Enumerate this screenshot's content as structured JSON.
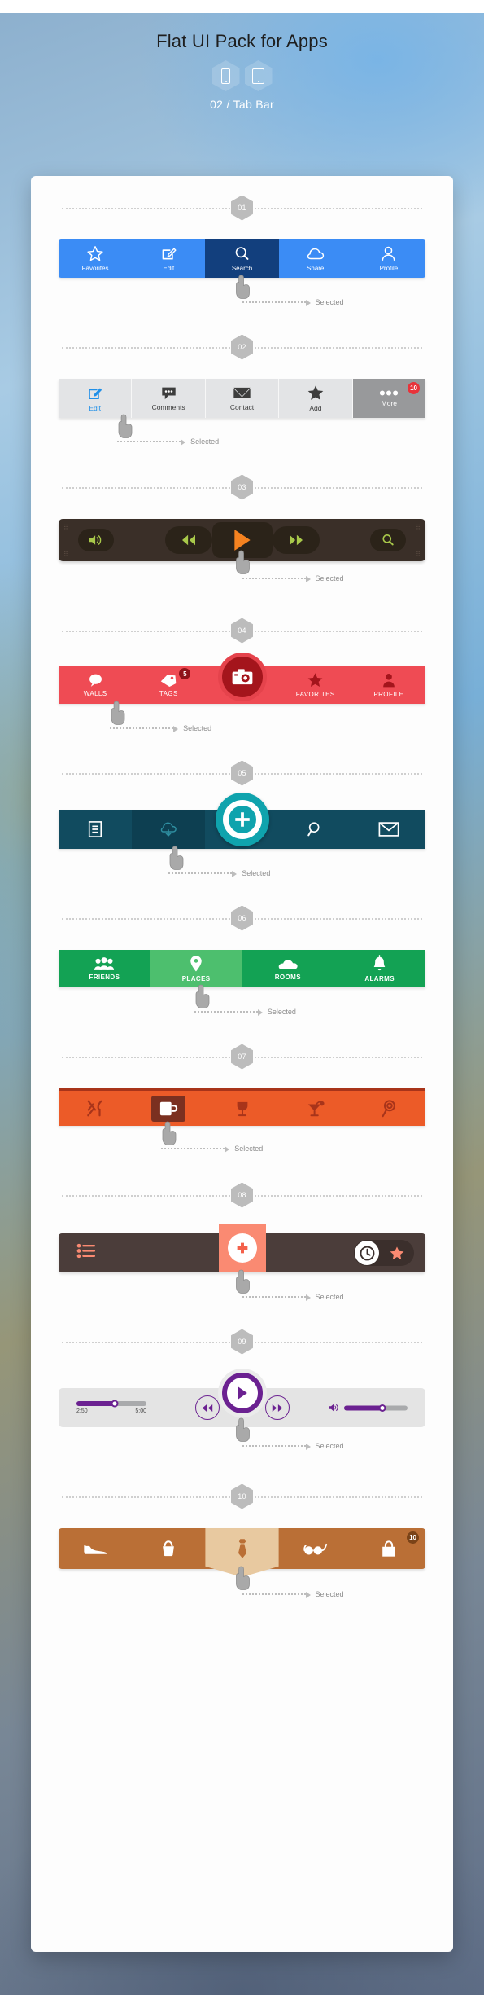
{
  "header": {
    "title": "Flat UI Pack for Apps",
    "subtitle": "02 / Tab Bar",
    "devices": [
      {
        "name": "phone-device-icon"
      },
      {
        "name": "tablet-device-icon"
      }
    ]
  },
  "annotation_label": "Selected",
  "colors": {
    "blue": "#3b8cf5",
    "blue_selected": "#123f7d",
    "gray": "#e3e4e6",
    "gray_selected": "#98999b",
    "gray_accent": "#1f8fe8",
    "dark_media": "#3a2f28",
    "orange_play": "#f58220",
    "green_media": "#a8c84a",
    "red": "#ef4b54",
    "red_dark": "#a4151c",
    "teal_dark": "#114b5f",
    "teal": "#0fa3ad",
    "green": "#13a254",
    "green_selected": "#4dbf6e",
    "orange": "#ec5b28",
    "orange_dark": "#7b3020",
    "brown_dark": "#4b3d3a",
    "coral": "#fa8a72",
    "purple": "#6b2191",
    "light_gray": "#e4e4e4",
    "brown": "#ba6f36",
    "tan": "#e8c9a0"
  },
  "sections": [
    {
      "number": "01",
      "style": "blue",
      "selected_index": 2,
      "tabs": [
        {
          "label": "Favorites",
          "icon": "star-outline-icon"
        },
        {
          "label": "Edit",
          "icon": "compose-pencil-icon"
        },
        {
          "label": "Search",
          "icon": "magnifier-icon"
        },
        {
          "label": "Share",
          "icon": "cloud-outline-icon"
        },
        {
          "label": "Profile",
          "icon": "person-outline-icon"
        }
      ]
    },
    {
      "number": "02",
      "style": "gray",
      "selected_index": 0,
      "tabs": [
        {
          "label": "Edit",
          "icon": "compose-pencil-icon"
        },
        {
          "label": "Comments",
          "icon": "speech-bubble-dots-icon"
        },
        {
          "label": "Contact",
          "icon": "envelope-icon"
        },
        {
          "label": "Add",
          "icon": "star-filled-icon"
        },
        {
          "label": "More",
          "icon": "ellipsis-icon",
          "badge": "10"
        }
      ]
    },
    {
      "number": "03",
      "style": "media-dark",
      "selected_index": 2,
      "tabs": [
        {
          "label": "",
          "icon": "volume-icon"
        },
        {
          "label": "",
          "icon": "rewind-icon"
        },
        {
          "label": "",
          "icon": "play-icon"
        },
        {
          "label": "",
          "icon": "fast-forward-icon"
        },
        {
          "label": "",
          "icon": "magnifier-icon"
        }
      ]
    },
    {
      "number": "04",
      "style": "red",
      "selected_index": 0,
      "tabs": [
        {
          "label": "WALLS",
          "icon": "speech-bubble-icon"
        },
        {
          "label": "TAGS",
          "icon": "tag-icon",
          "badge": "5"
        },
        {
          "label": "",
          "icon": "camera-icon"
        },
        {
          "label": "FAVORITES",
          "icon": "star-filled-icon"
        },
        {
          "label": "PROFILE",
          "icon": "person-filled-icon"
        }
      ]
    },
    {
      "number": "05",
      "style": "teal",
      "selected_index": 1,
      "tabs": [
        {
          "label": "",
          "icon": "document-lines-icon"
        },
        {
          "label": "",
          "icon": "cloud-download-icon"
        },
        {
          "label": "",
          "icon": "plus-circle-icon"
        },
        {
          "label": "",
          "icon": "magnifier-icon"
        },
        {
          "label": "",
          "icon": "envelope-icon"
        }
      ]
    },
    {
      "number": "06",
      "style": "green",
      "selected_index": 1,
      "tabs": [
        {
          "label": "FRIENDS",
          "icon": "people-group-icon"
        },
        {
          "label": "PLACES",
          "icon": "map-pin-icon"
        },
        {
          "label": "ROOMS",
          "icon": "cloud-filled-icon"
        },
        {
          "label": "ALARMS",
          "icon": "bell-icon"
        }
      ]
    },
    {
      "number": "07",
      "style": "orange",
      "selected_index": 1,
      "tabs": [
        {
          "label": "",
          "icon": "fork-knife-icon"
        },
        {
          "label": "",
          "icon": "coffee-mug-icon"
        },
        {
          "label": "",
          "icon": "wine-glass-icon"
        },
        {
          "label": "",
          "icon": "cocktail-icon"
        },
        {
          "label": "",
          "icon": "lollipop-icon"
        }
      ]
    },
    {
      "number": "08",
      "style": "brown-dark",
      "selected_index": 1,
      "tabs": [
        {
          "label": "",
          "icon": "list-bullets-icon"
        },
        {
          "label": "",
          "icon": "plus-circle-icon"
        },
        {
          "label": "",
          "icon": "clock-star-toggle-icon"
        }
      ]
    },
    {
      "number": "09",
      "style": "player",
      "selected_index": 1,
      "player": {
        "time_elapsed": "2:50",
        "time_total": "5:00",
        "progress_percent": 55,
        "volume_percent": 60,
        "controls": [
          "rewind-icon",
          "play-icon",
          "fast-forward-icon"
        ]
      },
      "tabs": []
    },
    {
      "number": "10",
      "style": "shop",
      "selected_index": 2,
      "tabs": [
        {
          "label": "",
          "icon": "shoe-icon"
        },
        {
          "label": "",
          "icon": "handbag-icon"
        },
        {
          "label": "",
          "icon": "necktie-icon"
        },
        {
          "label": "",
          "icon": "eyeglasses-icon"
        },
        {
          "label": "",
          "icon": "shopping-bag-icon",
          "badge": "10"
        }
      ]
    }
  ]
}
